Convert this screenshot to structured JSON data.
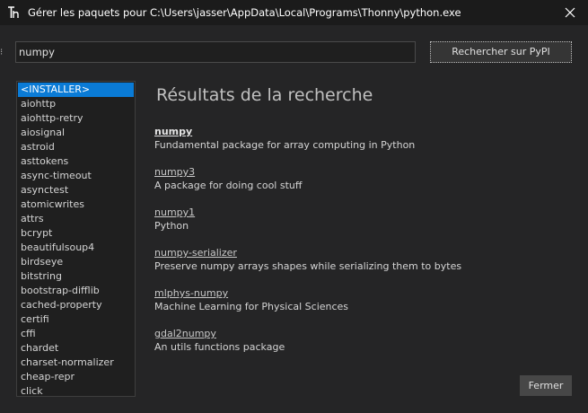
{
  "window": {
    "title": "Gérer les paquets pour C:\\Users\\jasser\\AppData\\Local\\Programs\\Thonny\\python.exe"
  },
  "search": {
    "value": "numpy",
    "button_label": "Rechercher sur PyPI"
  },
  "package_list": {
    "items": [
      "<INSTALLER>",
      "aiohttp",
      "aiohttp-retry",
      "aiosignal",
      "astroid",
      "asttokens",
      "async-timeout",
      "asynctest",
      "atomicwrites",
      "attrs",
      "bcrypt",
      "beautifulsoup4",
      "birdseye",
      "bitstring",
      "bootstrap-difflib",
      "cached-property",
      "certifi",
      "cffi",
      "chardet",
      "charset-normalizer",
      "cheap-repr",
      "click"
    ],
    "selected_index": 0
  },
  "results": {
    "title": "Résultats de la recherche",
    "items": [
      {
        "name": "numpy",
        "description": "Fundamental package for array computing in Python"
      },
      {
        "name": "numpy3",
        "description": "A package for doing cool stuff"
      },
      {
        "name": "numpy1",
        "description": "Python"
      },
      {
        "name": "numpy-serializer",
        "description": "Preserve numpy arrays shapes while serializing them to bytes"
      },
      {
        "name": "mlphys-numpy",
        "description": "Machine Learning for Physical Sciences"
      },
      {
        "name": "gdal2numpy",
        "description": "An utils functions package"
      }
    ]
  },
  "footer": {
    "close_label": "Fermer"
  },
  "colors": {
    "background": "#252526",
    "titlebar": "#1b1b1b",
    "selection": "#0a7bd6"
  }
}
